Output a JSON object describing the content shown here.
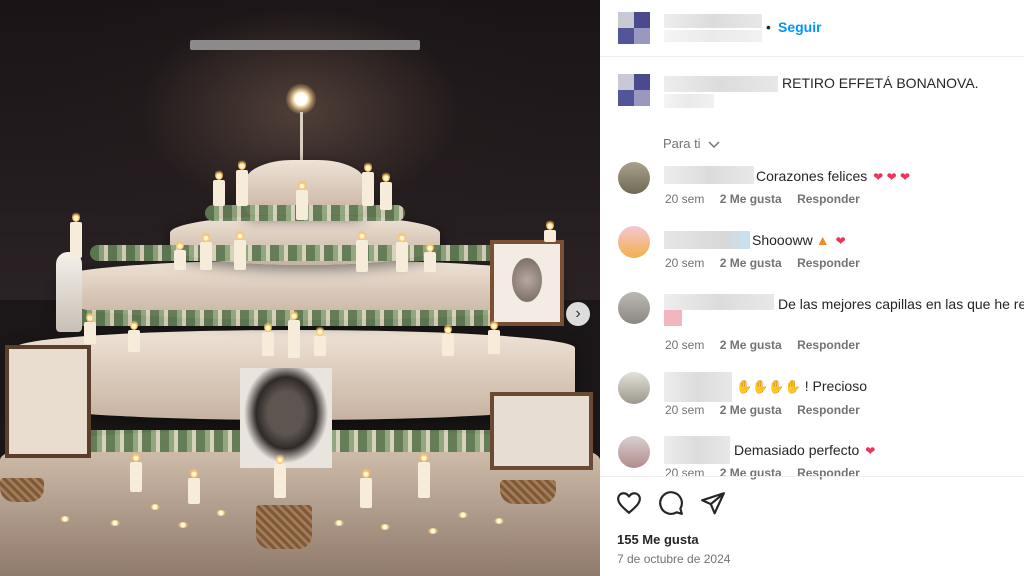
{
  "header": {
    "separator": "•",
    "follow_label": "Seguir"
  },
  "caption": {
    "text": "RETIRO EFFETÁ BONANOVA."
  },
  "sort": {
    "label": "Para ti",
    "icon": "chevron-down-icon"
  },
  "comments": [
    {
      "text": "Corazones felices",
      "emoji": "heart-eyes x3",
      "time": "20 sem",
      "likes": "2 Me gusta",
      "reply": "Responder"
    },
    {
      "text": "Shoooww",
      "emoji": "fire, heart-eyes",
      "time": "20 sem",
      "likes": "2 Me gusta",
      "reply": "Responder"
    },
    {
      "text": "De las mejores capillas en las que he reza",
      "time": "20 sem",
      "likes": "2 Me gusta",
      "reply": "Responder"
    },
    {
      "text": "! Precioso",
      "emoji": "clapping-hands x4",
      "time": "20 sem",
      "likes": "2 Me gusta",
      "reply": "Responder"
    },
    {
      "text": "Demasiado perfecto",
      "emoji": "heart-eyes",
      "time": "20 sem",
      "likes": "2 Me gusta",
      "reply": "Responder"
    }
  ],
  "post": {
    "likes": "155 Me gusta",
    "date": "7 de octubre de 2024"
  },
  "colors": {
    "link_blue": "#0095f6",
    "secondary_text": "#737373",
    "primary_text": "#262626"
  }
}
